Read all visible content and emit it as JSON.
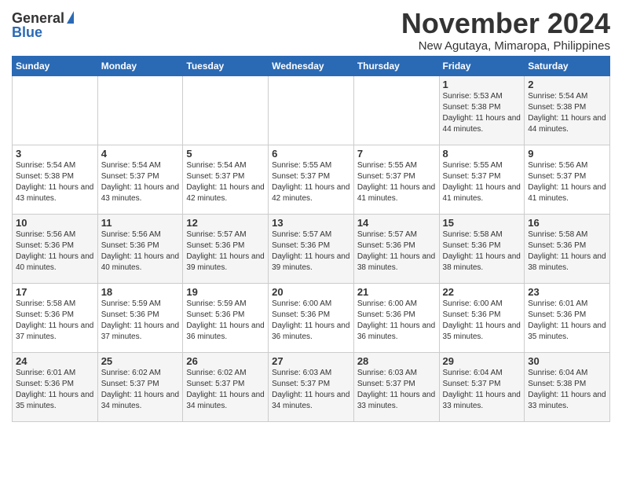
{
  "header": {
    "logo_general": "General",
    "logo_blue": "Blue",
    "month_title": "November 2024",
    "location": "New Agutaya, Mimaropa, Philippines"
  },
  "weekdays": [
    "Sunday",
    "Monday",
    "Tuesday",
    "Wednesday",
    "Thursday",
    "Friday",
    "Saturday"
  ],
  "weeks": [
    [
      {
        "day": "",
        "info": ""
      },
      {
        "day": "",
        "info": ""
      },
      {
        "day": "",
        "info": ""
      },
      {
        "day": "",
        "info": ""
      },
      {
        "day": "",
        "info": ""
      },
      {
        "day": "1",
        "info": "Sunrise: 5:53 AM\nSunset: 5:38 PM\nDaylight: 11 hours and 44 minutes."
      },
      {
        "day": "2",
        "info": "Sunrise: 5:54 AM\nSunset: 5:38 PM\nDaylight: 11 hours and 44 minutes."
      }
    ],
    [
      {
        "day": "3",
        "info": "Sunrise: 5:54 AM\nSunset: 5:38 PM\nDaylight: 11 hours and 43 minutes."
      },
      {
        "day": "4",
        "info": "Sunrise: 5:54 AM\nSunset: 5:37 PM\nDaylight: 11 hours and 43 minutes."
      },
      {
        "day": "5",
        "info": "Sunrise: 5:54 AM\nSunset: 5:37 PM\nDaylight: 11 hours and 42 minutes."
      },
      {
        "day": "6",
        "info": "Sunrise: 5:55 AM\nSunset: 5:37 PM\nDaylight: 11 hours and 42 minutes."
      },
      {
        "day": "7",
        "info": "Sunrise: 5:55 AM\nSunset: 5:37 PM\nDaylight: 11 hours and 41 minutes."
      },
      {
        "day": "8",
        "info": "Sunrise: 5:55 AM\nSunset: 5:37 PM\nDaylight: 11 hours and 41 minutes."
      },
      {
        "day": "9",
        "info": "Sunrise: 5:56 AM\nSunset: 5:37 PM\nDaylight: 11 hours and 41 minutes."
      }
    ],
    [
      {
        "day": "10",
        "info": "Sunrise: 5:56 AM\nSunset: 5:36 PM\nDaylight: 11 hours and 40 minutes."
      },
      {
        "day": "11",
        "info": "Sunrise: 5:56 AM\nSunset: 5:36 PM\nDaylight: 11 hours and 40 minutes."
      },
      {
        "day": "12",
        "info": "Sunrise: 5:57 AM\nSunset: 5:36 PM\nDaylight: 11 hours and 39 minutes."
      },
      {
        "day": "13",
        "info": "Sunrise: 5:57 AM\nSunset: 5:36 PM\nDaylight: 11 hours and 39 minutes."
      },
      {
        "day": "14",
        "info": "Sunrise: 5:57 AM\nSunset: 5:36 PM\nDaylight: 11 hours and 38 minutes."
      },
      {
        "day": "15",
        "info": "Sunrise: 5:58 AM\nSunset: 5:36 PM\nDaylight: 11 hours and 38 minutes."
      },
      {
        "day": "16",
        "info": "Sunrise: 5:58 AM\nSunset: 5:36 PM\nDaylight: 11 hours and 38 minutes."
      }
    ],
    [
      {
        "day": "17",
        "info": "Sunrise: 5:58 AM\nSunset: 5:36 PM\nDaylight: 11 hours and 37 minutes."
      },
      {
        "day": "18",
        "info": "Sunrise: 5:59 AM\nSunset: 5:36 PM\nDaylight: 11 hours and 37 minutes."
      },
      {
        "day": "19",
        "info": "Sunrise: 5:59 AM\nSunset: 5:36 PM\nDaylight: 11 hours and 36 minutes."
      },
      {
        "day": "20",
        "info": "Sunrise: 6:00 AM\nSunset: 5:36 PM\nDaylight: 11 hours and 36 minutes."
      },
      {
        "day": "21",
        "info": "Sunrise: 6:00 AM\nSunset: 5:36 PM\nDaylight: 11 hours and 36 minutes."
      },
      {
        "day": "22",
        "info": "Sunrise: 6:00 AM\nSunset: 5:36 PM\nDaylight: 11 hours and 35 minutes."
      },
      {
        "day": "23",
        "info": "Sunrise: 6:01 AM\nSunset: 5:36 PM\nDaylight: 11 hours and 35 minutes."
      }
    ],
    [
      {
        "day": "24",
        "info": "Sunrise: 6:01 AM\nSunset: 5:36 PM\nDaylight: 11 hours and 35 minutes."
      },
      {
        "day": "25",
        "info": "Sunrise: 6:02 AM\nSunset: 5:37 PM\nDaylight: 11 hours and 34 minutes."
      },
      {
        "day": "26",
        "info": "Sunrise: 6:02 AM\nSunset: 5:37 PM\nDaylight: 11 hours and 34 minutes."
      },
      {
        "day": "27",
        "info": "Sunrise: 6:03 AM\nSunset: 5:37 PM\nDaylight: 11 hours and 34 minutes."
      },
      {
        "day": "28",
        "info": "Sunrise: 6:03 AM\nSunset: 5:37 PM\nDaylight: 11 hours and 33 minutes."
      },
      {
        "day": "29",
        "info": "Sunrise: 6:04 AM\nSunset: 5:37 PM\nDaylight: 11 hours and 33 minutes."
      },
      {
        "day": "30",
        "info": "Sunrise: 6:04 AM\nSunset: 5:38 PM\nDaylight: 11 hours and 33 minutes."
      }
    ]
  ]
}
